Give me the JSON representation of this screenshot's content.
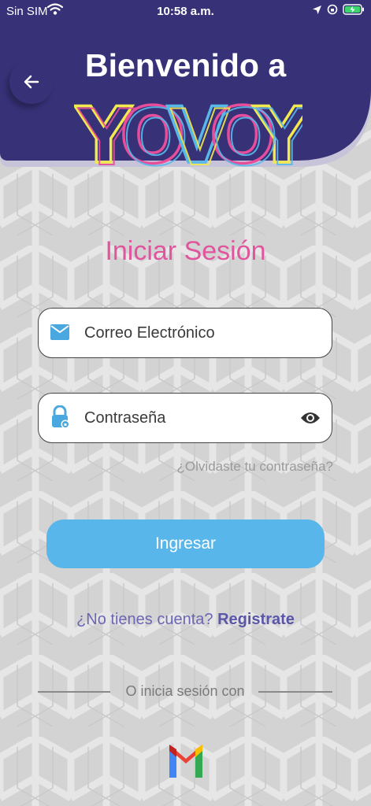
{
  "status_bar": {
    "carrier": "Sin SIM",
    "time": "10:58 a.m.",
    "icons": [
      "wifi-icon",
      "location-arrow-icon",
      "orientation-lock-icon",
      "battery-charging-icon"
    ]
  },
  "header": {
    "welcome": "Bienvenido a",
    "logo_text": "YOVOY",
    "background_color": "#373177",
    "logo_colors": [
      "#f2e94e",
      "#e64e9b",
      "#59b8ea"
    ]
  },
  "login": {
    "title": "Iniciar Sesión",
    "email_placeholder": "Correo Electrónico",
    "password_placeholder": "Contraseña",
    "forgot_password": "¿Olvidaste tu contraseña?",
    "submit_label": "Ingresar",
    "signup_prompt": "¿No tienes cuenta?",
    "signup_link": "Registrate",
    "alt_login_label": "O inicia sesión con",
    "alt_login_provider_icon": "gmail-icon"
  },
  "colors": {
    "accent_pink": "#e0559d",
    "accent_blue": "#58b6ea",
    "link_purple": "#5a56a8"
  }
}
